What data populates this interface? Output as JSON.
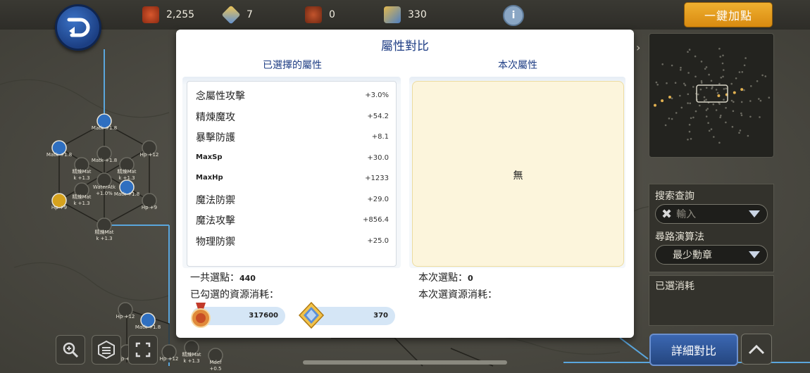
{
  "topbar": {
    "resources": [
      {
        "icon": "medal-icon",
        "value": "2,255"
      },
      {
        "icon": "crystal-icon",
        "value": "7"
      },
      {
        "icon": "locked-medal-icon",
        "value": "0"
      },
      {
        "icon": "locked-crystal-icon",
        "value": "330"
      }
    ],
    "info_label": "i",
    "one_key_label": "一鍵加點"
  },
  "dialog": {
    "title": "屬性對比",
    "selected_header": "已選擇的屬性",
    "current_header": "本次屬性",
    "attributes": [
      {
        "name": "念屬性攻擊",
        "value": "+3.0%"
      },
      {
        "name": "精煉魔攻",
        "value": "+54.2"
      },
      {
        "name": "暴擊防護",
        "value": "+8.1"
      },
      {
        "name": "MaxSp",
        "value": "+30.0"
      },
      {
        "name": "MaxHp",
        "value": "+1233"
      },
      {
        "name": "魔法防禦",
        "value": "+29.0"
      },
      {
        "name": "魔法攻擊",
        "value": "+856.4"
      },
      {
        "name": "物理防禦",
        "value": "+25.0"
      }
    ],
    "current_empty": "無",
    "total_points_label": "一共選點：",
    "total_points_value": "440",
    "checked_cost_label": "已勾選的資源消耗：",
    "costs": [
      {
        "icon": "medal-icon",
        "value": "317600"
      },
      {
        "icon": "crystal-icon",
        "value": "370"
      }
    ],
    "current_points_label": "本次選點：",
    "current_points_value": "0",
    "current_cost_label": "本次選資源消耗："
  },
  "side": {
    "search_label": "搜索查詢",
    "search_placeholder": "輸入",
    "path_label": "尋路演算法",
    "path_value": "最少勳章",
    "consumed_label": "已選消耗",
    "detail_button": "詳細對比"
  },
  "map_nodes": [
    {
      "line1": "Matk +1.8",
      "line2": ""
    },
    {
      "line1": "Matk +1.8",
      "line2": ""
    },
    {
      "line1": "Matk +1.8",
      "line2": ""
    },
    {
      "line1": "Hp +12",
      "line2": ""
    },
    {
      "line1": "精煉Mat",
      "line2": "k +1.3"
    },
    {
      "line1": "精煉Mat",
      "line2": "k +1.3"
    },
    {
      "line1": "WaterAtk",
      "line2": "+1.0%"
    },
    {
      "line1": "精煉Mat",
      "line2": "k +1.3"
    },
    {
      "line1": "Matk +1.8",
      "line2": ""
    },
    {
      "line1": "Hp +9",
      "line2": ""
    },
    {
      "line1": "Hp +9",
      "line2": ""
    },
    {
      "line1": "精煉Mat",
      "line2": "k +1.3"
    },
    {
      "line1": "Hp +12",
      "line2": ""
    },
    {
      "line1": "Matk +1.8",
      "line2": ""
    },
    {
      "line1": "Hp +12",
      "line2": ""
    },
    {
      "line1": "Hp +12",
      "line2": ""
    },
    {
      "line1": "精煉Mat",
      "line2": "k +1.3"
    },
    {
      "line1": "Mdef",
      "line2": "+0.5"
    }
  ],
  "colors": {
    "accent": "#1e3d84",
    "gold": "#e8a020",
    "panel_bg": "#fcf5dc"
  }
}
